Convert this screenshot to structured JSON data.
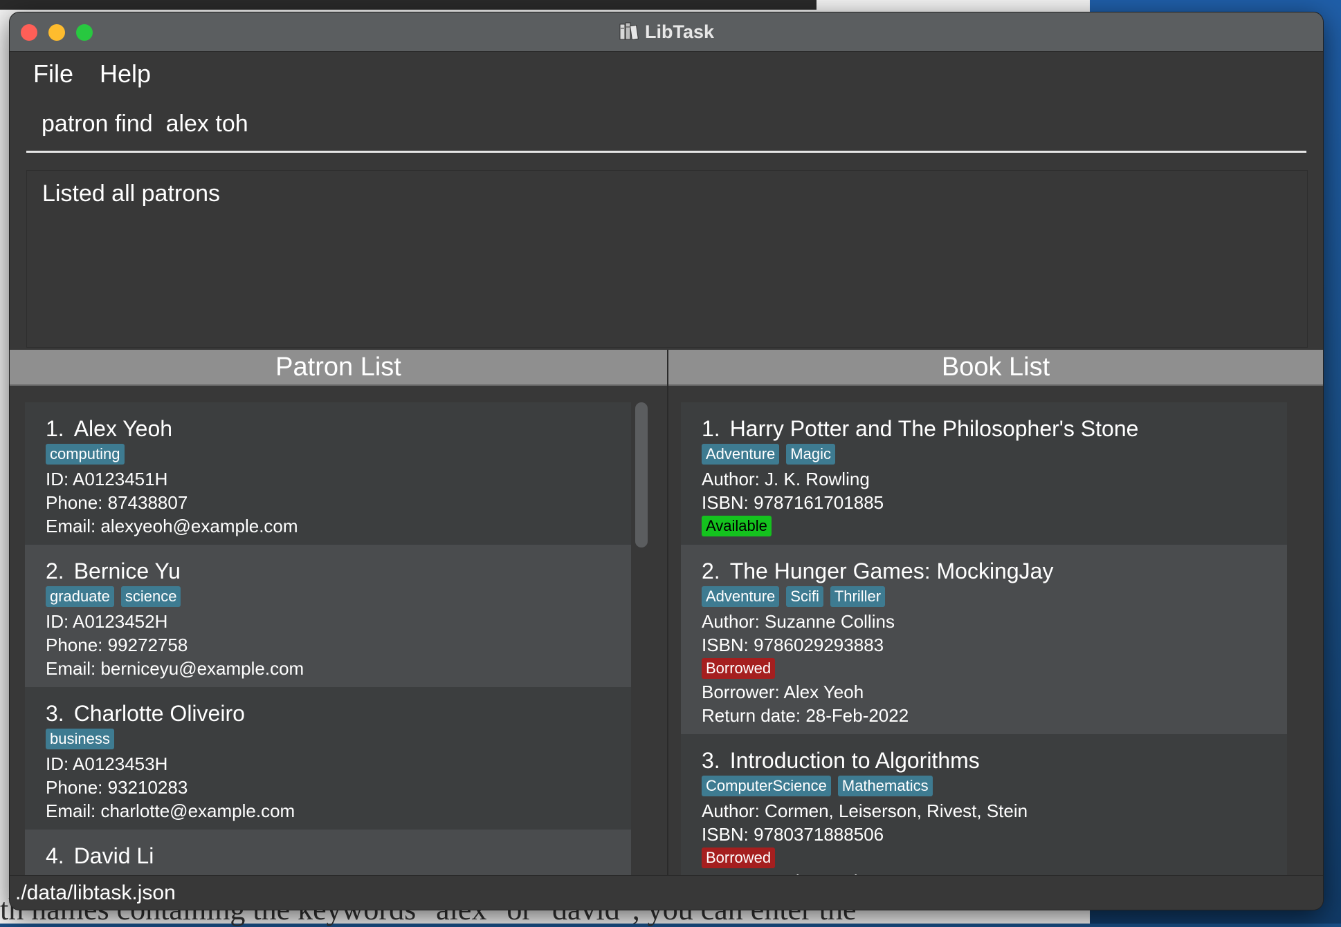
{
  "window": {
    "title": "LibTask"
  },
  "menu": {
    "items": [
      {
        "label": "File"
      },
      {
        "label": "Help"
      }
    ]
  },
  "command": {
    "value": "patron find  alex toh"
  },
  "result": {
    "text": "Listed all patrons"
  },
  "patron_list": {
    "header": "Patron List",
    "patrons": [
      {
        "index": "1.",
        "name": "Alex Yeoh",
        "tags": [
          "computing"
        ],
        "id": "ID: A0123451H",
        "phone": "Phone: 87438807",
        "email": "Email: alexyeoh@example.com"
      },
      {
        "index": "2.",
        "name": "Bernice Yu",
        "tags": [
          "graduate",
          "science"
        ],
        "id": "ID: A0123452H",
        "phone": "Phone: 99272758",
        "email": "Email: berniceyu@example.com"
      },
      {
        "index": "3.",
        "name": "Charlotte Oliveiro",
        "tags": [
          "business"
        ],
        "id": "ID: A0123453H",
        "phone": "Phone: 93210283",
        "email": "Email: charlotte@example.com"
      },
      {
        "index": "4.",
        "name": "David Li",
        "tags": [],
        "id": "",
        "phone": "",
        "email": ""
      }
    ]
  },
  "book_list": {
    "header": "Book List",
    "books": [
      {
        "index": "1.",
        "title": "Harry Potter and The Philosopher's Stone",
        "tags": [
          "Adventure",
          "Magic"
        ],
        "author": "Author: J. K. Rowling",
        "isbn": "ISBN: 9787161701885",
        "status": "Available",
        "status_type": "available",
        "borrower": "",
        "return_date": ""
      },
      {
        "index": "2.",
        "title": "The Hunger Games: MockingJay",
        "tags": [
          "Adventure",
          "Scifi",
          "Thriller"
        ],
        "author": "Author: Suzanne Collins",
        "isbn": "ISBN: 9786029293883",
        "status": "Borrowed",
        "status_type": "borrowed",
        "borrower": "Borrower: Alex Yeoh",
        "return_date": "Return date: 28-Feb-2022"
      },
      {
        "index": "3.",
        "title": "Introduction to Algorithms",
        "tags": [
          "ComputerScience",
          "Mathematics"
        ],
        "author": "Author: Cormen, Leiserson, Rivest, Stein",
        "isbn": "ISBN: 9780371888506",
        "status": "Borrowed",
        "status_type": "borrowed",
        "borrower": "Borrower: Alex Yeoh",
        "return_date": ""
      }
    ]
  },
  "statusbar": {
    "path": "./data/libtask.json"
  },
  "background": {
    "text": "th names containing the keywords \"alex\" or \"david\", you can enter the"
  },
  "colors": {
    "tag": "#3e7b91",
    "available": "#14c21e",
    "borrowed": "#a51f1f",
    "header": "#8f8f8f"
  }
}
